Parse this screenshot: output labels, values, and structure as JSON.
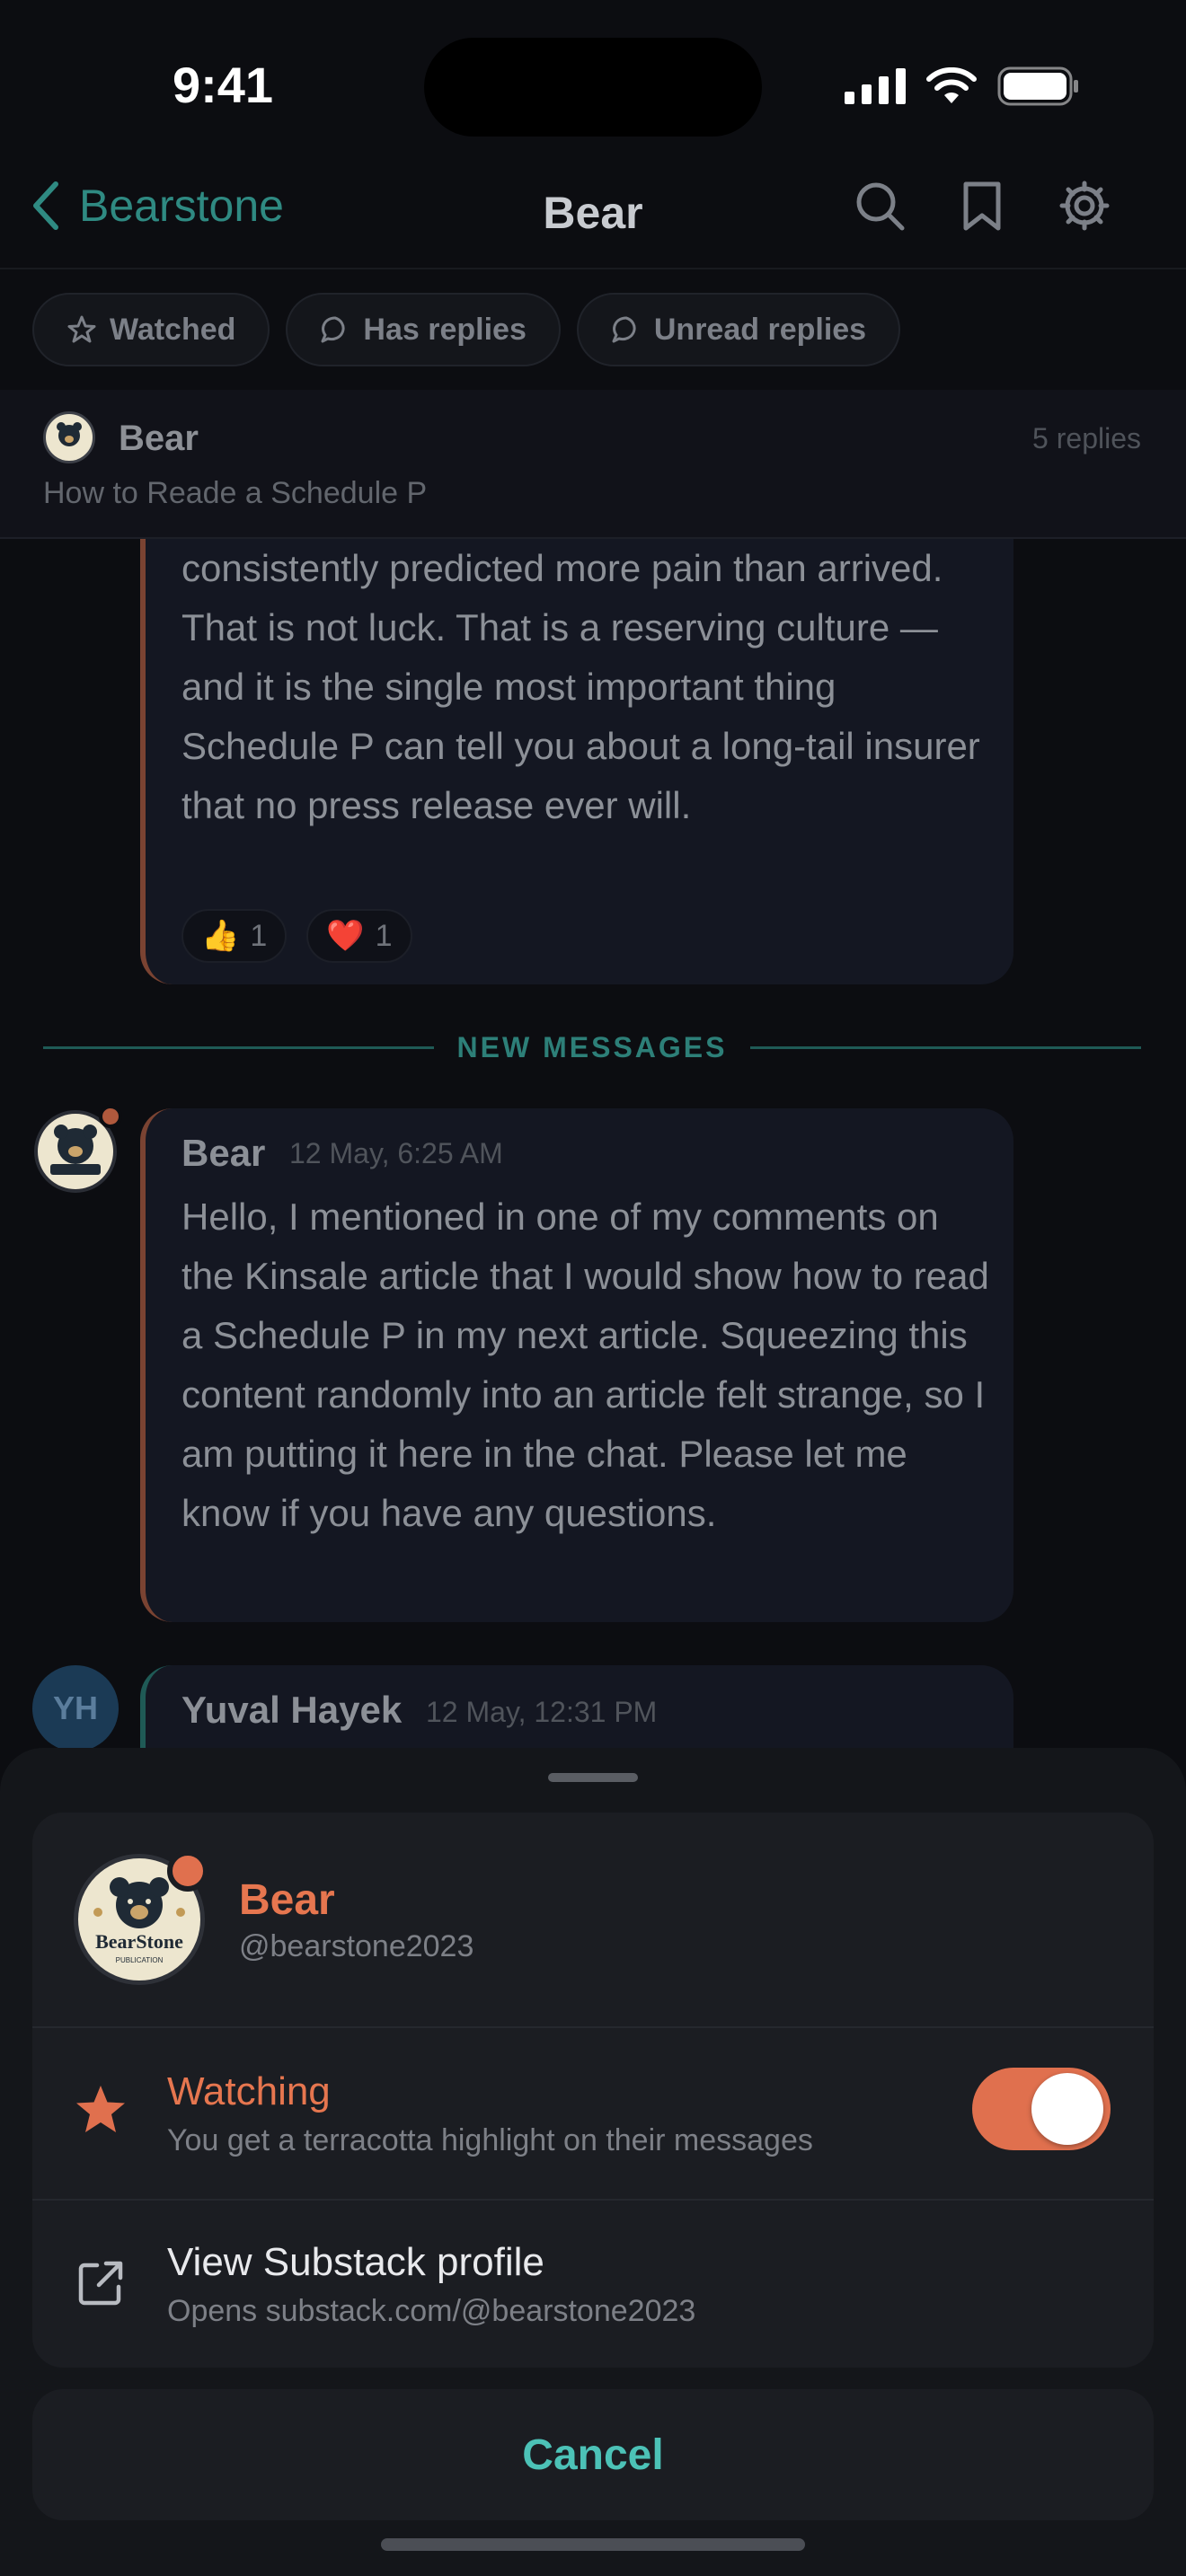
{
  "status_bar": {
    "time": "9:41"
  },
  "nav": {
    "back_label": "Bearstone",
    "title": "Bear",
    "icons": [
      "search-icon",
      "bookmark-icon",
      "gear-icon"
    ]
  },
  "filters": [
    {
      "label": "Watched",
      "icon": "star-outline-icon"
    },
    {
      "label": "Has replies",
      "icon": "chat-bubble-icon"
    },
    {
      "label": "Unread replies",
      "icon": "chat-bubble-icon"
    }
  ],
  "thread": {
    "author": "Bear",
    "replies": "5 replies",
    "subject": "How to Reade a Schedule P"
  },
  "messages": [
    {
      "text": "consistently predicted more pain than arrived. That is not luck. That is a reserving culture — and it is the single most important thing Schedule P can tell you about a long-tail insurer that no press release ever will.",
      "reactions": [
        {
          "emoji": "👍",
          "count": "1"
        },
        {
          "emoji": "❤️",
          "count": "1"
        }
      ]
    },
    {
      "author": "Bear",
      "time": "12 May, 6:25 AM",
      "text": "Hello, I mentioned in one of my comments on the Kinsale article that I would show how to read a Schedule P in my next article. Squeezing this content randomly into an article felt strange, so I am putting it here in the chat. Please let me know if you have any questions."
    },
    {
      "author": "Yuval Hayek",
      "initials": "YH",
      "time": "12 May, 12:31 PM"
    }
  ],
  "divider_label": "NEW MESSAGES",
  "sheet": {
    "profile": {
      "name": "Bear",
      "handle": "@bearstone2023",
      "logo_text": "BearStone",
      "logo_sub": "PUBLICATION"
    },
    "watching": {
      "title": "Watching",
      "subtitle": "You get a terracotta highlight on their messages",
      "enabled": true
    },
    "view_profile": {
      "title": "View Substack profile",
      "subtitle": "Opens substack.com/@bearstone2023"
    },
    "cancel_label": "Cancel"
  },
  "colors": {
    "accent_teal": "#4cc2b7",
    "terracotta": "#e0704e",
    "background": "#0c0d11"
  }
}
